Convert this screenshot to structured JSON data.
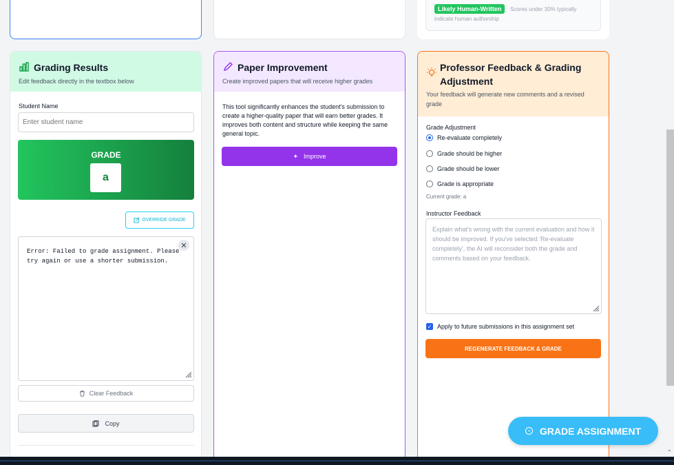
{
  "top": {
    "likely_badge": "Likely Human-Written",
    "ai_note_line1": "Scores under 30% typically",
    "ai_note_line2": "indicate human authorship"
  },
  "grading": {
    "title": "Grading Results",
    "subtitle": "Edit feedback directly in the textbox below",
    "student_name_label": "Student Name",
    "student_name_placeholder": "Enter student name",
    "grade_heading": "GRADE",
    "grade_value": "a",
    "override_label": "OVERRIDE GRADE",
    "feedback_text": "Error: Failed to grade assignment. Please try again or use a shorter submission.",
    "clear_label": "Clear Feedback",
    "copy_label": "Copy"
  },
  "improvement": {
    "title": "Paper Improvement",
    "subtitle": "Create improved papers that will receive higher grades",
    "description": "This tool significantly enhances the student's submission to create a higher-quality paper that will earn better grades. It improves both content and structure while keeping the same general topic.",
    "button_label": "Improve"
  },
  "professor": {
    "title_line1": "Professor Feedback & Grading",
    "title_line2": "Adjustment",
    "subtitle_line1": "Your feedback will generate new comments and a revised",
    "subtitle_line2": "grade",
    "adjustment_label": "Grade Adjustment",
    "options": [
      {
        "label": "Re-evaluate completely",
        "checked": true
      },
      {
        "label": "Grade should be higher",
        "checked": false
      },
      {
        "label": "Grade should be lower",
        "checked": false
      },
      {
        "label": "Grade is appropriate",
        "checked": false
      }
    ],
    "current_grade": "Current grade: a",
    "instructor_label": "Instructor Feedback",
    "instructor_placeholder": "Explain what's wrong with the current evaluation and how it should be improved. If you've selected 'Re-evaluate completely', the AI will reconsider both the grade and comments based on your feedback.",
    "apply_label": "Apply to future submissions in this assignment set",
    "apply_checked": true,
    "regenerate_label": "REGENERATE FEEDBACK & GRADE"
  },
  "fab": {
    "label": "GRADE ASSIGNMENT"
  },
  "colors": {
    "grading_accent": "#16a34a",
    "improve_accent": "#9333ea",
    "professor_accent": "#f97316",
    "fab": "#38bdf8"
  }
}
